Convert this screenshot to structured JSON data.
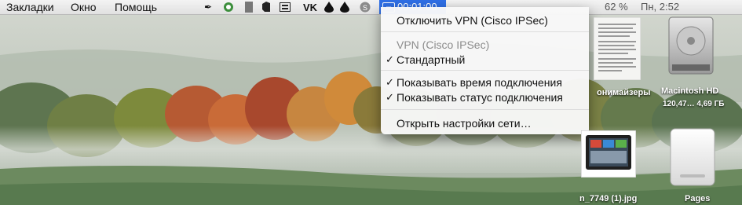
{
  "menubar": {
    "items": [
      "Закладки",
      "Окно",
      "Помощь"
    ],
    "status_icons": [
      "feather-icon",
      "sync-icon",
      "info-icon",
      "evernote-icon",
      "keyboard-icon",
      "vk-icon",
      "drop-icon",
      "drop-icon",
      "skype-icon"
    ],
    "vk_label": "VK",
    "vpn_time": "00:01:00",
    "partial_right": [
      "62 %",
      "Пн, 2:52"
    ]
  },
  "vpn_menu": {
    "disconnect": "Отключить VPN (Cisco IPSec)",
    "section_header": "VPN (Cisco IPSec)",
    "standard": "Стандартный",
    "show_time": "Показывать время подключения",
    "show_status": "Показывать статус подключения",
    "open_settings": "Открыть настройки сети…",
    "check_mark": "✓"
  },
  "desktop": {
    "anonymizers_label": "онимайзеры",
    "hd_name": "Macintosh HD",
    "hd_size": "120,47… 4,69 ГБ",
    "jpg_label": "n_7749 (1).jpg",
    "pages_label": "Pages"
  },
  "colors": {
    "highlight": "#2f6fe6",
    "menu_bg": "#f8f8f8"
  }
}
